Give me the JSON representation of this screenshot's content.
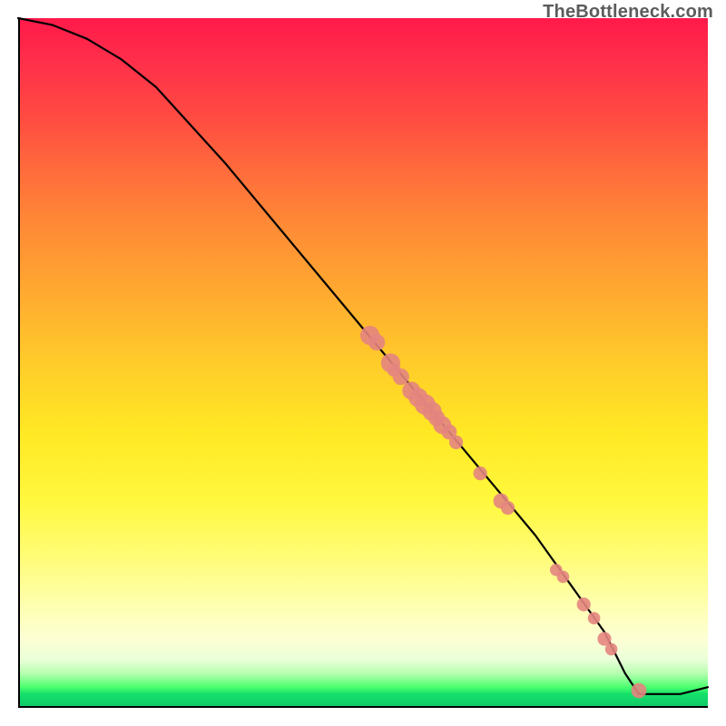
{
  "watermark": "TheBottleneck.com",
  "chart_data": {
    "type": "line",
    "title": "",
    "xlabel": "",
    "ylabel": "",
    "xlim": [
      0,
      100
    ],
    "ylim": [
      0,
      100
    ],
    "grid": false,
    "legend": false,
    "curve": [
      {
        "x": 0,
        "y": 100
      },
      {
        "x": 5,
        "y": 99
      },
      {
        "x": 10,
        "y": 97
      },
      {
        "x": 15,
        "y": 94
      },
      {
        "x": 20,
        "y": 90
      },
      {
        "x": 30,
        "y": 79
      },
      {
        "x": 40,
        "y": 67
      },
      {
        "x": 50,
        "y": 55
      },
      {
        "x": 55,
        "y": 49
      },
      {
        "x": 60,
        "y": 43
      },
      {
        "x": 65,
        "y": 37
      },
      {
        "x": 70,
        "y": 31
      },
      {
        "x": 75,
        "y": 25
      },
      {
        "x": 80,
        "y": 18
      },
      {
        "x": 85,
        "y": 11
      },
      {
        "x": 88,
        "y": 5
      },
      {
        "x": 90,
        "y": 2
      },
      {
        "x": 92,
        "y": 2
      },
      {
        "x": 96,
        "y": 2
      },
      {
        "x": 100,
        "y": 3
      }
    ],
    "markers": [
      {
        "x": 51,
        "y": 54,
        "r": 1.4
      },
      {
        "x": 52,
        "y": 53,
        "r": 1.2
      },
      {
        "x": 54,
        "y": 50,
        "r": 1.4
      },
      {
        "x": 54.5,
        "y": 49,
        "r": 1.0
      },
      {
        "x": 55.5,
        "y": 48,
        "r": 1.2
      },
      {
        "x": 57,
        "y": 46,
        "r": 1.3
      },
      {
        "x": 58,
        "y": 45,
        "r": 1.4
      },
      {
        "x": 59,
        "y": 44,
        "r": 1.5
      },
      {
        "x": 60,
        "y": 43,
        "r": 1.4
      },
      {
        "x": 60.7,
        "y": 42,
        "r": 1.2
      },
      {
        "x": 61.5,
        "y": 41,
        "r": 1.3
      },
      {
        "x": 62.5,
        "y": 40,
        "r": 1.1
      },
      {
        "x": 63.5,
        "y": 38.5,
        "r": 1.0
      },
      {
        "x": 67,
        "y": 34,
        "r": 1.0
      },
      {
        "x": 70,
        "y": 30,
        "r": 1.1
      },
      {
        "x": 71,
        "y": 29,
        "r": 1.0
      },
      {
        "x": 78,
        "y": 20,
        "r": 0.9
      },
      {
        "x": 79,
        "y": 19,
        "r": 0.9
      },
      {
        "x": 82,
        "y": 15,
        "r": 1.0
      },
      {
        "x": 83.5,
        "y": 13,
        "r": 0.9
      },
      {
        "x": 85,
        "y": 10,
        "r": 1.0
      },
      {
        "x": 86,
        "y": 8.5,
        "r": 0.9
      },
      {
        "x": 90,
        "y": 2.5,
        "r": 1.1
      }
    ],
    "colors": {
      "curve": "#000000",
      "marker_fill": "#e4857f",
      "marker_stroke": "#d26b65"
    }
  }
}
